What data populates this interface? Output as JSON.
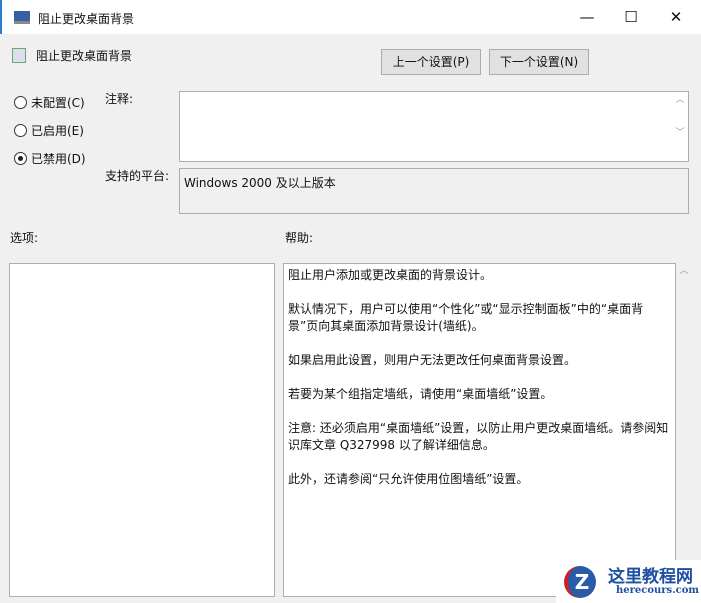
{
  "window": {
    "title": "阻止更改桌面背景",
    "minimize": "—",
    "maximize": "☐",
    "close": "✕"
  },
  "header": {
    "title": "阻止更改桌面背景",
    "prev_button": "上一个设置(P)",
    "next_button": "下一个设置(N)"
  },
  "radios": [
    {
      "label": "未配置(C)",
      "checked": false
    },
    {
      "label": "已启用(E)",
      "checked": false
    },
    {
      "label": "已禁用(D)",
      "checked": true
    }
  ],
  "comment": {
    "label": "注释:",
    "value": ""
  },
  "platform": {
    "label": "支持的平台:",
    "value": "Windows 2000 及以上版本"
  },
  "options": {
    "label": "选项:"
  },
  "help": {
    "label": "帮助:",
    "paragraphs": [
      "阻止用户添加或更改桌面的背景设计。",
      "默认情况下，用户可以使用“个性化”或“显示控制面板”中的“桌面背景”页向其桌面添加背景设计(墙纸)。",
      "如果启用此设置，则用户无法更改任何桌面背景设置。",
      "若要为某个组指定墙纸，请使用“桌面墙纸”设置。",
      "注意: 还必须启用“桌面墙纸”设置，以防止用户更改桌面墙纸。请参阅知识库文章 Q327998 以了解详细信息。",
      "此外，还请参阅“只允许使用位图墙纸”设置。"
    ]
  },
  "watermark": {
    "name": "这里教程网",
    "url": "herecours.com"
  }
}
